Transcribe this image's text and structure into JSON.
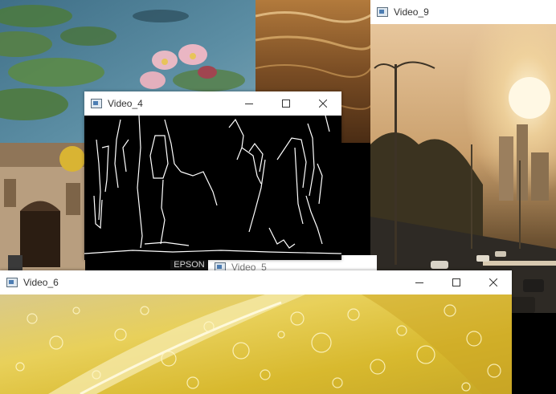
{
  "windows": {
    "video_4": {
      "title": "Video_4"
    },
    "video_5": {
      "title": "Video_5"
    },
    "video_6": {
      "title": "Video_6"
    },
    "video_9": {
      "title": "Video_9"
    }
  },
  "labels": {
    "epson": "EPSON"
  },
  "colors": {
    "titlebar": "#ffffff",
    "title_text": "#333333",
    "edge_background": "#000000",
    "edge_lines": "#ffffff"
  }
}
